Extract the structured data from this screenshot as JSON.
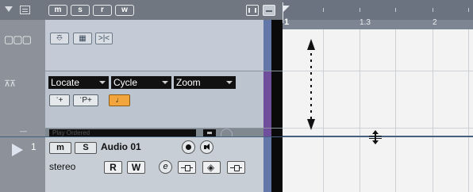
{
  "header": {
    "buttons": [
      "m",
      "s",
      "r",
      "w"
    ]
  },
  "video_track": {
    "buttons": [
      "lock",
      "snap",
      "edit"
    ]
  },
  "marker_track": {
    "dropdowns": [
      {
        "label": "Locate"
      },
      {
        "label": "Cycle"
      },
      {
        "label": "Zoom"
      }
    ],
    "buttons": [
      "ॱ+",
      "ॱP+"
    ]
  },
  "hidden_row": {
    "preset_text": "Play Ordered"
  },
  "audio_track": {
    "number": "1",
    "mute": "m",
    "solo": "S",
    "name": "Audio 01",
    "channel": "stereo",
    "read": "R",
    "write": "W",
    "edit": "e"
  },
  "ruler": {
    "labels": [
      "1",
      "1.3",
      "2"
    ]
  },
  "colors": {
    "video_stripe": "#6378a9",
    "marker_stripe": "#6f4f9c",
    "audio_stripe": "#6378a9",
    "focus_line": "#46607f",
    "accent_button": "#f1a53c"
  }
}
